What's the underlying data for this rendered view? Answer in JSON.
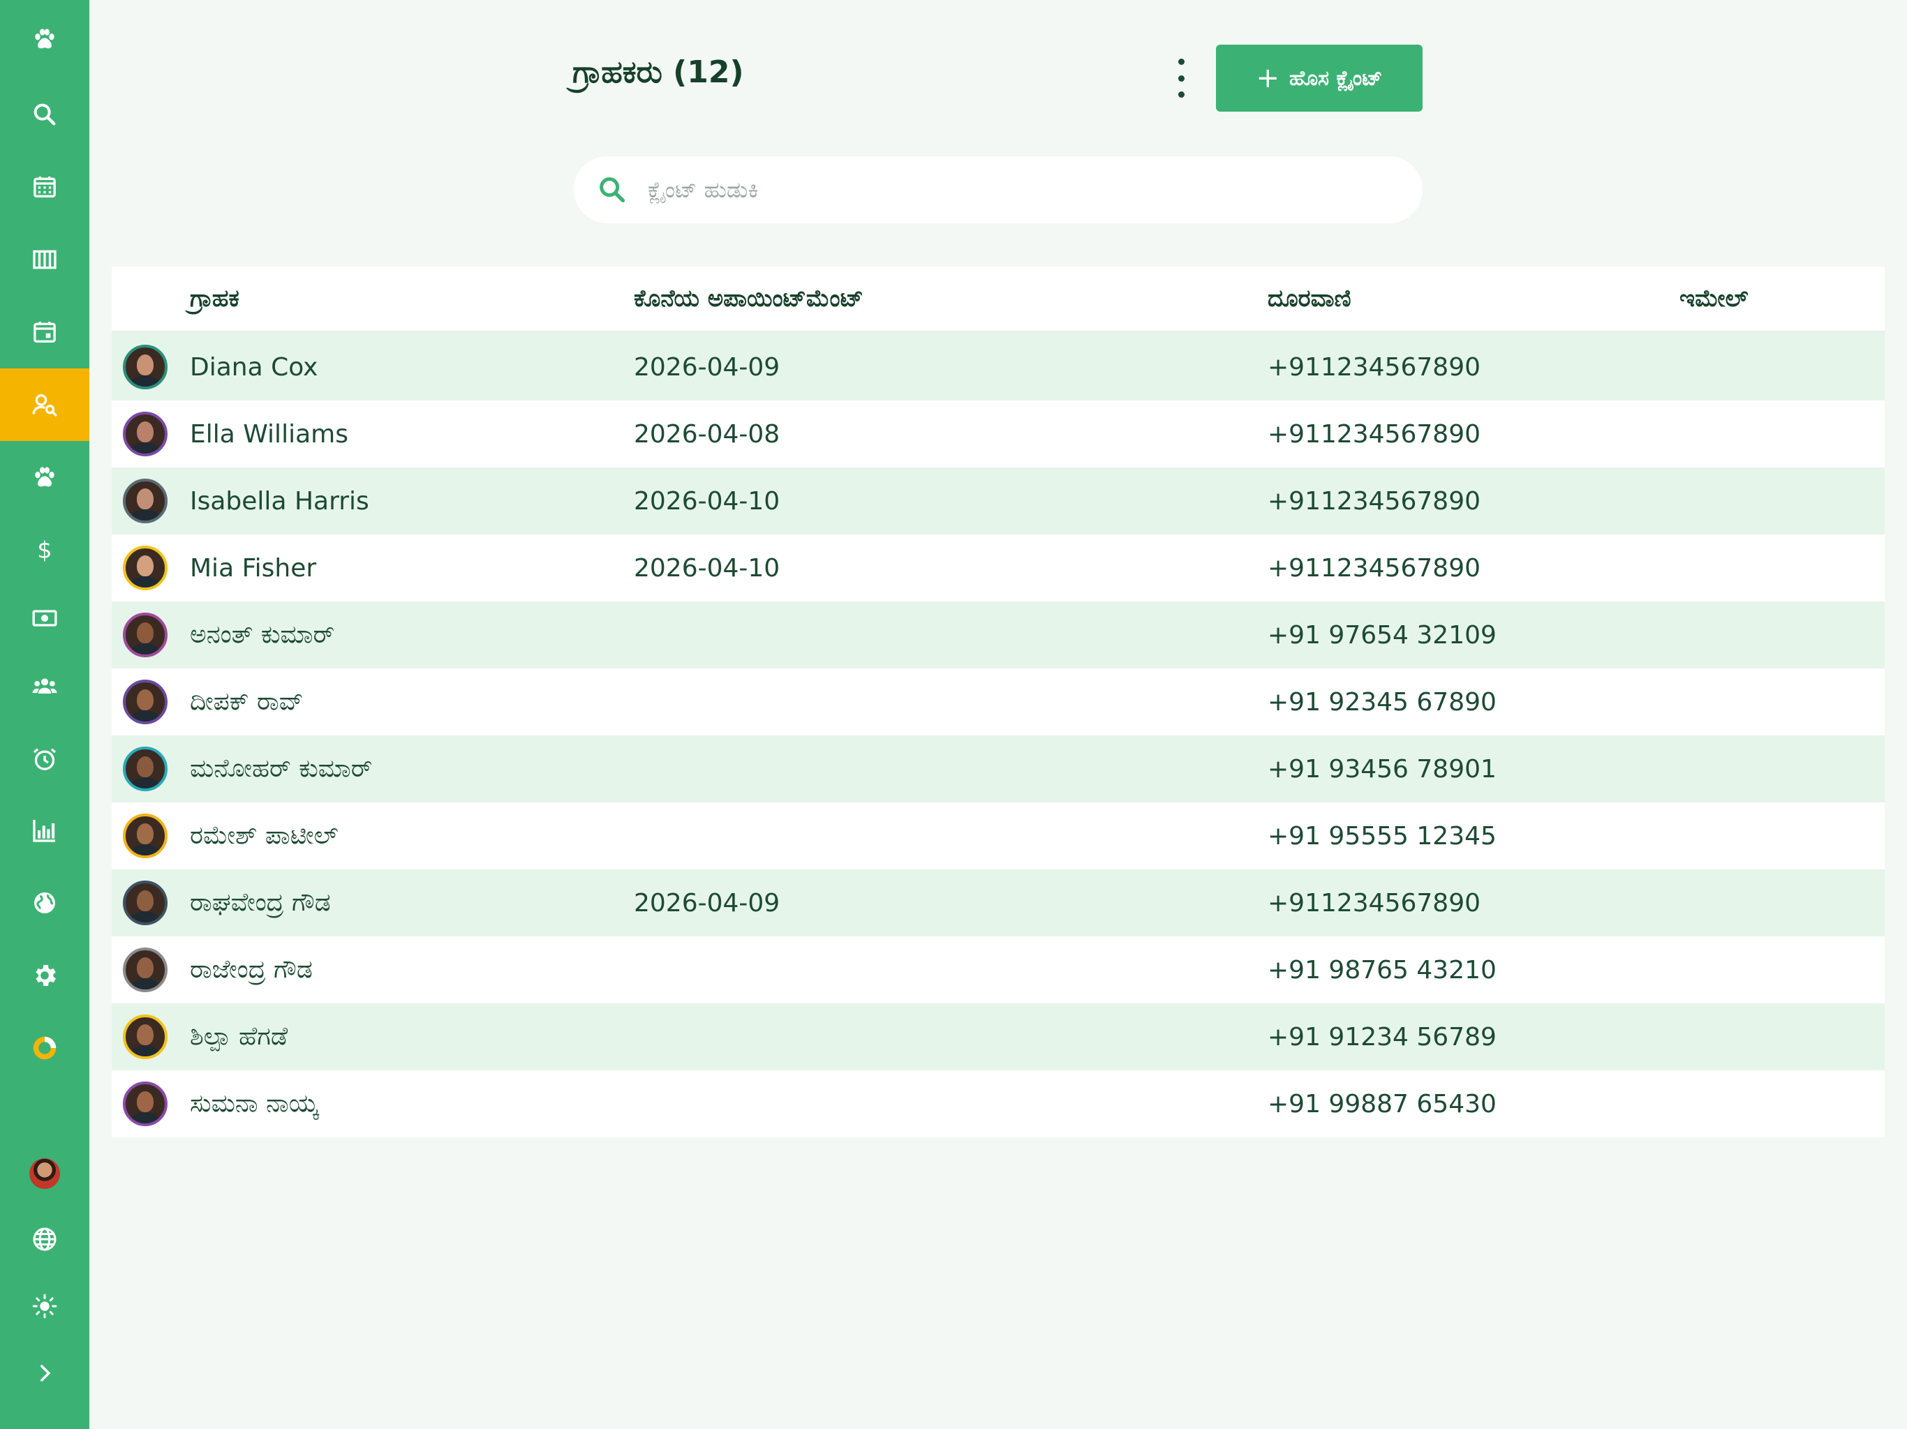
{
  "sidebar": {
    "items": [
      {
        "icon": "paw-icon",
        "active": false
      },
      {
        "icon": "search-icon",
        "active": false
      },
      {
        "icon": "calendar-icon",
        "active": false
      },
      {
        "icon": "columns-icon",
        "active": false
      },
      {
        "icon": "calendar-day-icon",
        "active": false
      },
      {
        "icon": "client-search-icon",
        "active": true
      },
      {
        "icon": "paw-icon",
        "active": false
      },
      {
        "icon": "dollar-icon",
        "active": false
      },
      {
        "icon": "cash-icon",
        "active": false
      },
      {
        "icon": "team-icon",
        "active": false
      },
      {
        "icon": "alarm-icon",
        "active": false
      },
      {
        "icon": "bar-chart-icon",
        "active": false
      },
      {
        "icon": "globe-filled-icon",
        "active": false
      },
      {
        "icon": "gear-icon",
        "active": false
      },
      {
        "icon": "donut-icon",
        "active": false
      }
    ],
    "bottom": [
      "user-avatar",
      "language-globe-icon",
      "theme-sun-icon",
      "expand-chevron-icon"
    ],
    "accent": "#3bb273",
    "active_color": "#f5b400"
  },
  "header": {
    "title": "ಗ್ರಾಹಕರು (12)",
    "new_button_label": "ಹೊಸ ಕ್ಲೈಂಟ್",
    "new_button_plus": "+"
  },
  "search": {
    "placeholder": "ಕ್ಲೈಂಟ್ ಹುಡುಕಿ",
    "value": ""
  },
  "table": {
    "columns": [
      "ಗ್ರಾಹಕ",
      "ಕೊನೆಯ ಅಪಾಯಿಂಟ್‌ಮೆಂಟ್",
      "ದೂರವಾಣಿ",
      "ಇಮೇಲ್"
    ],
    "rows": [
      {
        "name": "Diana Cox",
        "last": "2026-04-09",
        "phone": "+911234567890",
        "email": "",
        "ring": "#2a8f7a",
        "skin": "#c99274"
      },
      {
        "name": "Ella Williams",
        "last": "2026-04-08",
        "phone": "+911234567890",
        "email": "",
        "ring": "#7a4aa8",
        "skin": "#b9806a"
      },
      {
        "name": "Isabella Harris",
        "last": "2026-04-10",
        "phone": "+911234567890",
        "email": "",
        "ring": "#5a6a72",
        "skin": "#c28f76"
      },
      {
        "name": "Mia Fisher",
        "last": "2026-04-10",
        "phone": "+911234567890",
        "email": "",
        "ring": "#f2c21b",
        "skin": "#d4a080"
      },
      {
        "name": "ಅನಂತ್ ಕುಮಾರ್",
        "last": "",
        "phone": "+91 97654 32109",
        "email": "",
        "ring": "#a04a9a",
        "skin": "#8e5a3c"
      },
      {
        "name": "ದೀಪಕ್ ರಾವ್",
        "last": "",
        "phone": "+91 92345 67890",
        "email": "",
        "ring": "#6a4aa0",
        "skin": "#9a6646"
      },
      {
        "name": "ಮನೋಹರ್ ಕುಮಾರ್",
        "last": "",
        "phone": "+91 93456 78901",
        "email": "",
        "ring": "#28a9b8",
        "skin": "#8a5a3e"
      },
      {
        "name": "ರಮೇಶ್ ಪಾಟೀಲ್",
        "last": "",
        "phone": "+91 95555 12345",
        "email": "",
        "ring": "#f2b21b",
        "skin": "#a06c48"
      },
      {
        "name": "ರಾಘವೇಂದ್ರ ಗೌಡ",
        "last": "2026-04-09",
        "phone": "+911234567890",
        "email": "",
        "ring": "#3e5260",
        "skin": "#8e5e40"
      },
      {
        "name": "ರಾಜೇಂದ್ರ ಗೌಡ",
        "last": "",
        "phone": "+91 98765 43210",
        "email": "",
        "ring": "#8a8a8a",
        "skin": "#946044"
      },
      {
        "name": "ಶಿಲ್ಪಾ ಹೆಗಡೆ",
        "last": "",
        "phone": "+91 91234 56789",
        "email": "",
        "ring": "#f2c21b",
        "skin": "#a06a4a"
      },
      {
        "name": "ಸುಮನಾ ನಾಯ್ಕ",
        "last": "",
        "phone": "+91 99887 65430",
        "email": "",
        "ring": "#8a4aa8",
        "skin": "#9e6646"
      }
    ]
  }
}
